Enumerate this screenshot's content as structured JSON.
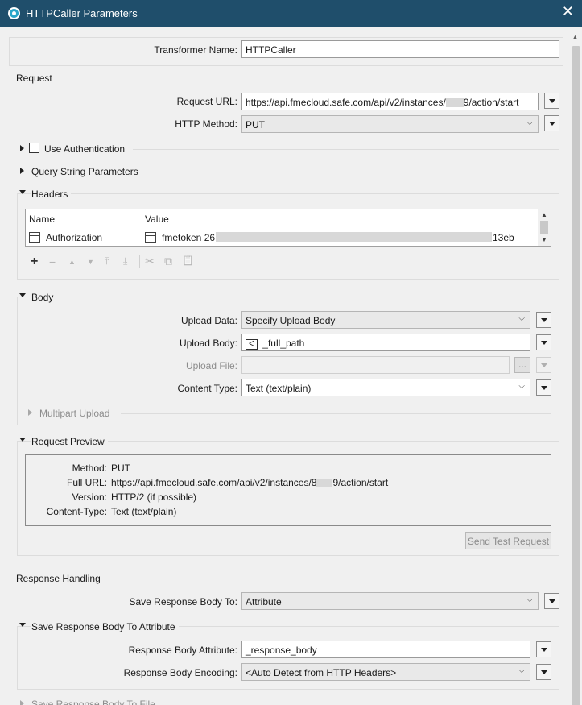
{
  "window": {
    "title": "HTTPCaller Parameters",
    "close_glyph": "✕"
  },
  "transformer": {
    "label": "Transformer Name:",
    "value": "HTTPCaller"
  },
  "request": {
    "section_title": "Request",
    "url_label": "Request URL:",
    "url_prefix": "https://api.fmecloud.safe.com/api/v2/instances/",
    "url_suffix": "9/action/start",
    "method_label": "HTTP Method:",
    "method_value": "PUT",
    "use_auth_label": "Use Authentication",
    "query_label": "Query String Parameters",
    "headers_label": "Headers",
    "headers_table": {
      "col_name": "Name",
      "col_value": "Value",
      "rows": [
        {
          "name": "Authorization",
          "value_prefix": "fmetoken 26",
          "value_suffix": "13eb"
        }
      ]
    }
  },
  "body": {
    "section_title": "Body",
    "upload_data_label": "Upload Data:",
    "upload_data_value": "Specify Upload Body",
    "upload_body_label": "Upload Body:",
    "upload_body_value": "_full_path",
    "upload_file_label": "Upload File:",
    "browse_label": "...",
    "content_type_label": "Content Type:",
    "content_type_value": "Text (text/plain)",
    "multipart_label": "Multipart Upload"
  },
  "preview": {
    "section_title": "Request Preview",
    "method_key": "Method:",
    "method_val": "PUT",
    "url_key": "Full URL:",
    "url_prefix": "https://api.fmecloud.safe.com/api/v2/instances/",
    "url_mid": "8",
    "url_suffix": "9/action/start",
    "version_key": "Version:",
    "version_val": "HTTP/2 (if possible)",
    "ctype_key": "Content-Type:",
    "ctype_val": "Text (text/plain)",
    "send_button": "Send Test Request"
  },
  "response": {
    "section_title": "Response Handling",
    "save_to_label": "Save Response Body To:",
    "save_to_value": "Attribute",
    "attr_section_title": "Save Response Body To Attribute",
    "attr_label": "Response Body Attribute:",
    "attr_value": "_response_body",
    "encoding_label": "Response Body Encoding:",
    "encoding_value": "<Auto Detect from HTTP Headers>",
    "file_section_title": "Save Response Body To File"
  },
  "icons": {
    "add": "+",
    "remove": "−",
    "move_up": "▲",
    "move_down": "▼",
    "move_top": "⤒",
    "move_bottom": "⤓",
    "cut": "✂",
    "copy": "⧉",
    "paste": "📋",
    "chevron": "⌵",
    "attribute": "ᐸ"
  }
}
